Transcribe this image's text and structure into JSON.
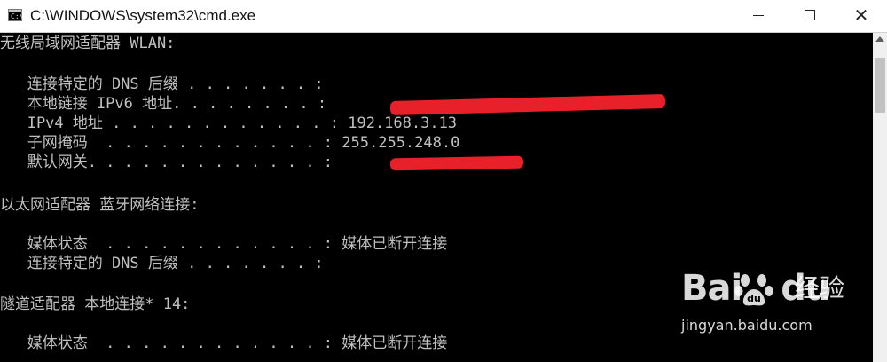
{
  "window": {
    "title": "C:\\WINDOWS\\system32\\cmd.exe",
    "icon": "cmd-app-icon",
    "icon_glyph": "C:\\",
    "minimize_label": "",
    "maximize_label": "",
    "close_label": "✕"
  },
  "console": {
    "lines": [
      "无线局域网适配器 WLAN:",
      "",
      "   连接特定的 DNS 后缀 . . . . . . . :",
      "   本地链接 IPv6 地址. . . . . . . . : ",
      "   IPv4 地址 . . . . . . . . . . . . : 192.168.3.13",
      "   子网掩码  . . . . . . . . . . . . : 255.255.248.0",
      "   默认网关. . . . . . . . . . . . . : ",
      "",
      "以太网适配器 蓝牙网络连接:",
      "",
      "   媒体状态  . . . . . . . . . . . . : 媒体已断开连接",
      "   连接特定的 DNS 后缀 . . . . . . . :",
      "",
      "隧道适配器 本地连接* 14:",
      "",
      "   媒体状态  . . . . . . . . . . . . : 媒体已断开连接"
    ],
    "text_color": "#c0c0c0",
    "background": "#000000",
    "redaction_color": "#e8202a"
  },
  "watermark": {
    "brand": "Bai",
    "brand_tail": "du",
    "brand_cn": "经验",
    "url": "jingyan.baidu.com"
  }
}
